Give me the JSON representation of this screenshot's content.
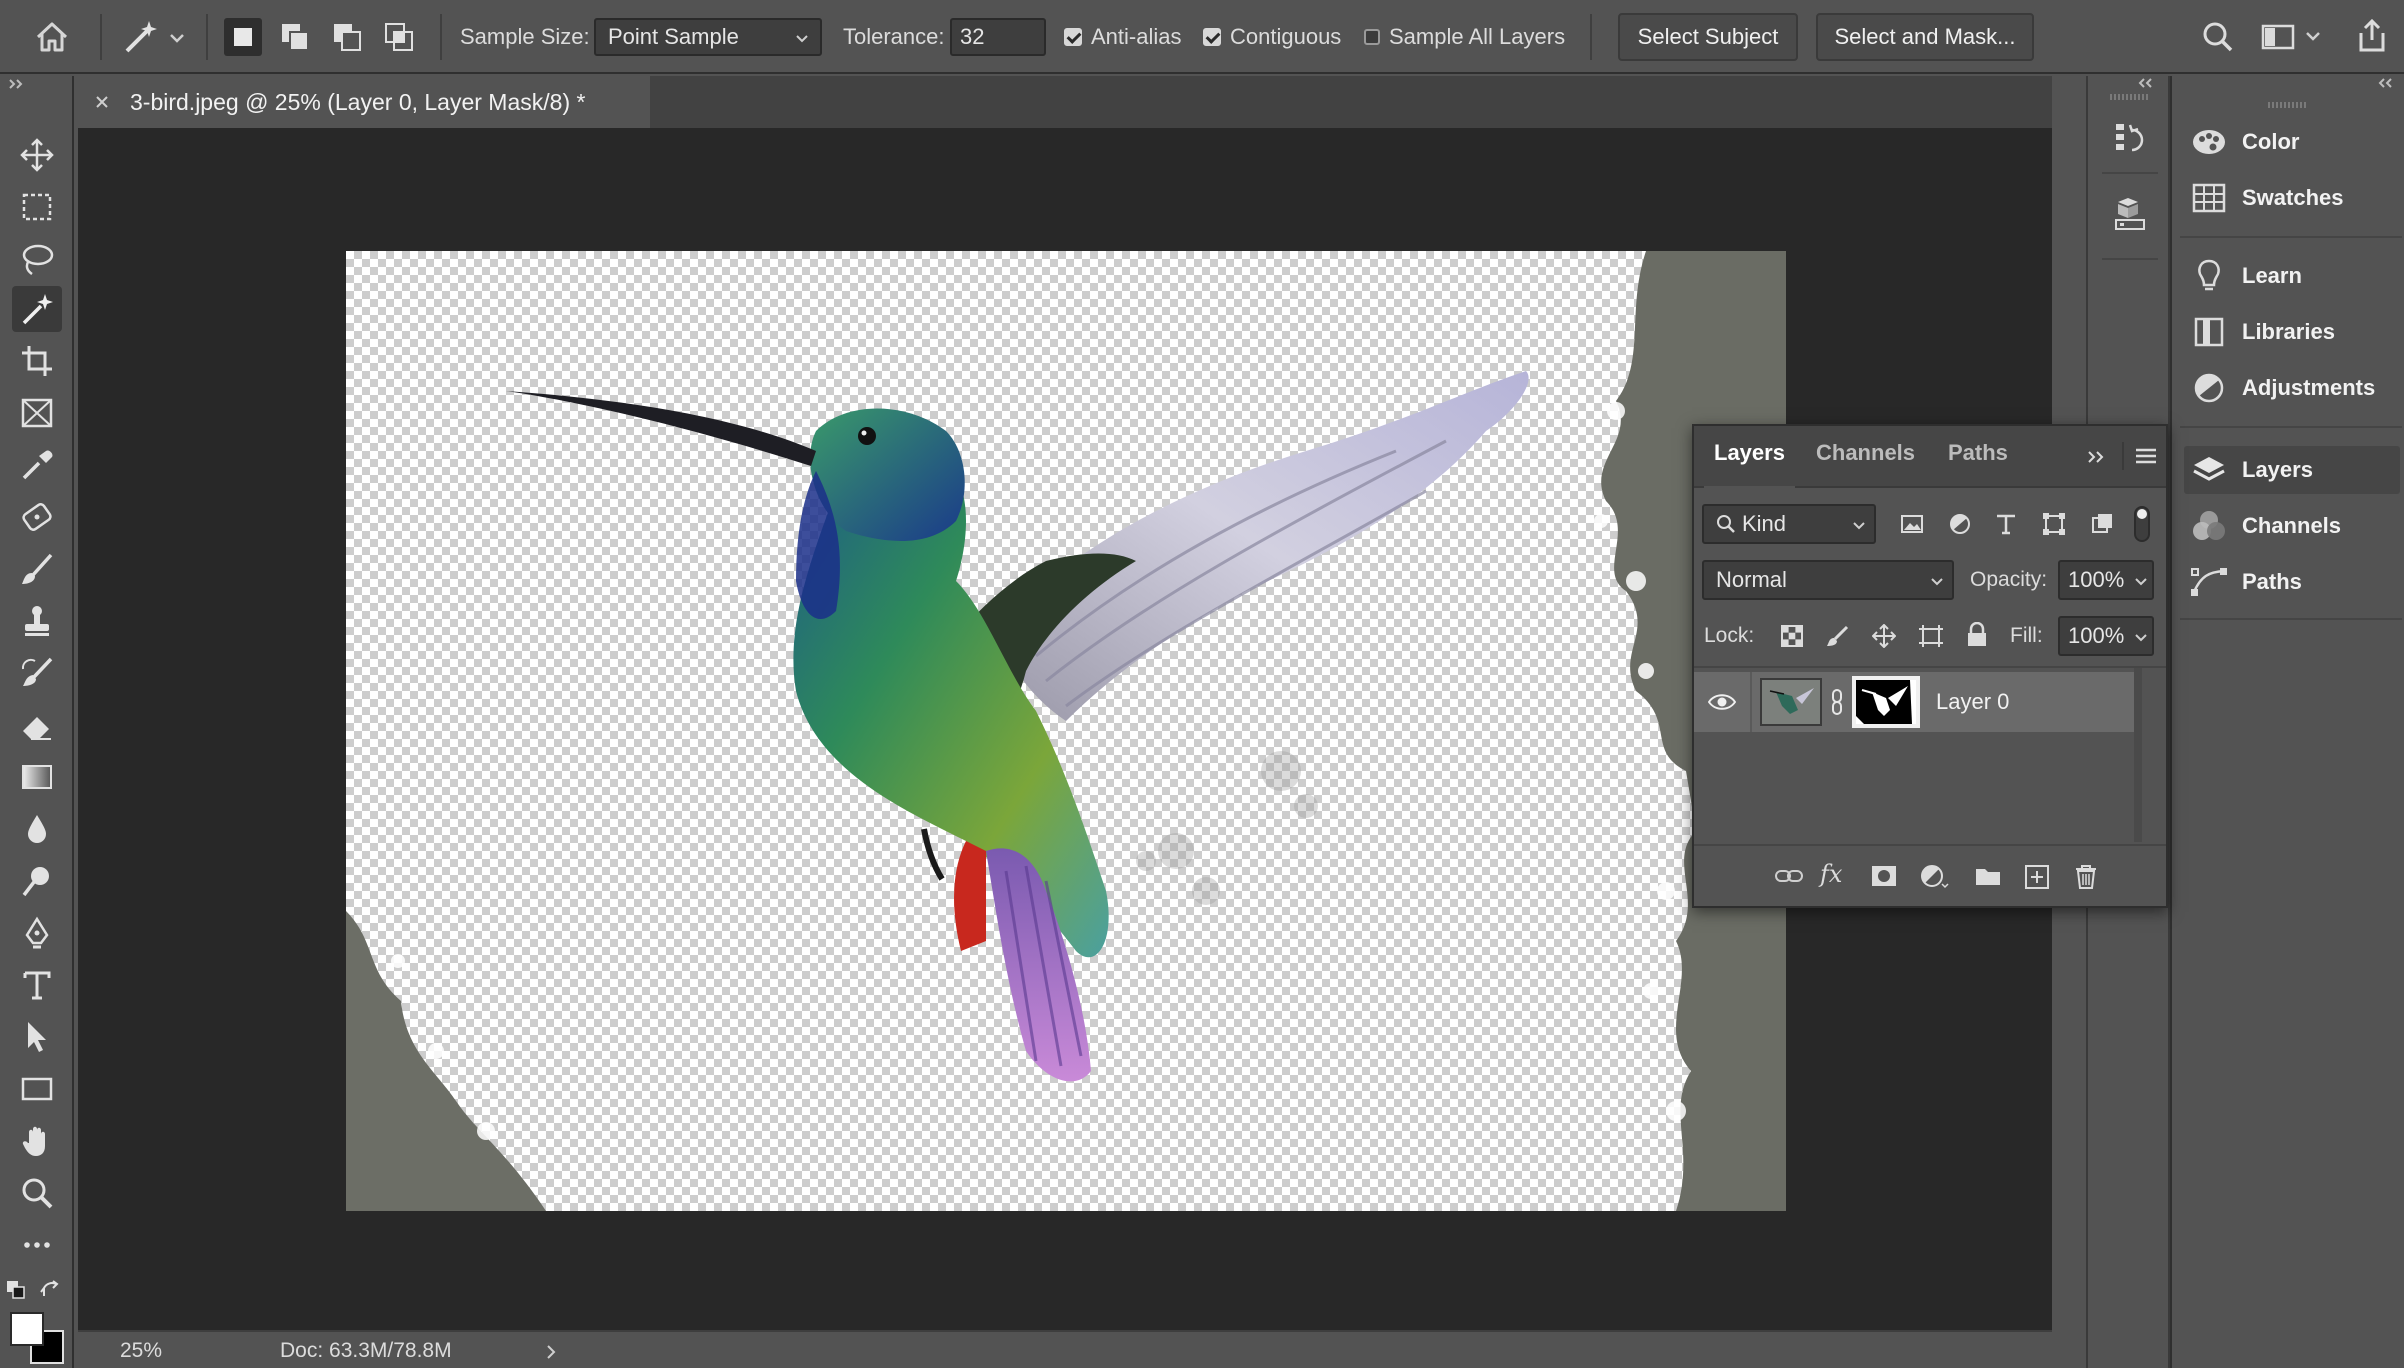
{
  "options_bar": {
    "sample_size_label": "Sample Size:",
    "sample_size_value": "Point Sample",
    "tolerance_label": "Tolerance:",
    "tolerance_value": "32",
    "anti_alias_label": "Anti-alias",
    "anti_alias_checked": true,
    "contiguous_label": "Contiguous",
    "contiguous_checked": true,
    "sample_all_layers_label": "Sample All Layers",
    "sample_all_layers_checked": false,
    "select_subject_label": "Select Subject",
    "select_and_mask_label": "Select and Mask..."
  },
  "document": {
    "tab_title": "3-bird.jpeg @ 25% (Layer 0, Layer Mask/8) *"
  },
  "status_bar": {
    "zoom": "25%",
    "doc_size": "Doc: 63.3M/78.8M"
  },
  "tools": [
    "move-tool",
    "marquee-tool",
    "lasso-tool",
    "magic-wand-tool",
    "crop-tool",
    "frame-tool",
    "eyedropper-tool",
    "healing-brush-tool",
    "brush-tool",
    "clone-stamp-tool",
    "history-brush-tool",
    "eraser-tool",
    "gradient-tool",
    "blur-tool",
    "dodge-tool",
    "pen-tool",
    "type-tool",
    "path-selection-tool",
    "rectangle-tool",
    "hand-tool",
    "zoom-tool",
    "more-tools"
  ],
  "right_panel": {
    "group1": [
      {
        "label": "Color",
        "icon": "color-palette-icon"
      },
      {
        "label": "Swatches",
        "icon": "swatches-grid-icon"
      }
    ],
    "group2": [
      {
        "label": "Learn",
        "icon": "lightbulb-icon"
      },
      {
        "label": "Libraries",
        "icon": "libraries-icon"
      },
      {
        "label": "Adjustments",
        "icon": "adjustments-icon"
      }
    ],
    "group3": [
      {
        "label": "Layers",
        "icon": "layers-icon",
        "active": true
      },
      {
        "label": "Channels",
        "icon": "channels-icon"
      },
      {
        "label": "Paths",
        "icon": "paths-icon"
      }
    ]
  },
  "layers_panel": {
    "tabs": [
      "Layers",
      "Channels",
      "Paths"
    ],
    "active_tab": "Layers",
    "filter_kind": "Kind",
    "blend_mode": "Normal",
    "opacity_label": "Opacity:",
    "opacity_value": "100%",
    "lock_label": "Lock:",
    "fill_label": "Fill:",
    "fill_value": "100%",
    "layers": [
      {
        "name": "Layer 0",
        "visible": true,
        "has_mask": true
      }
    ]
  }
}
